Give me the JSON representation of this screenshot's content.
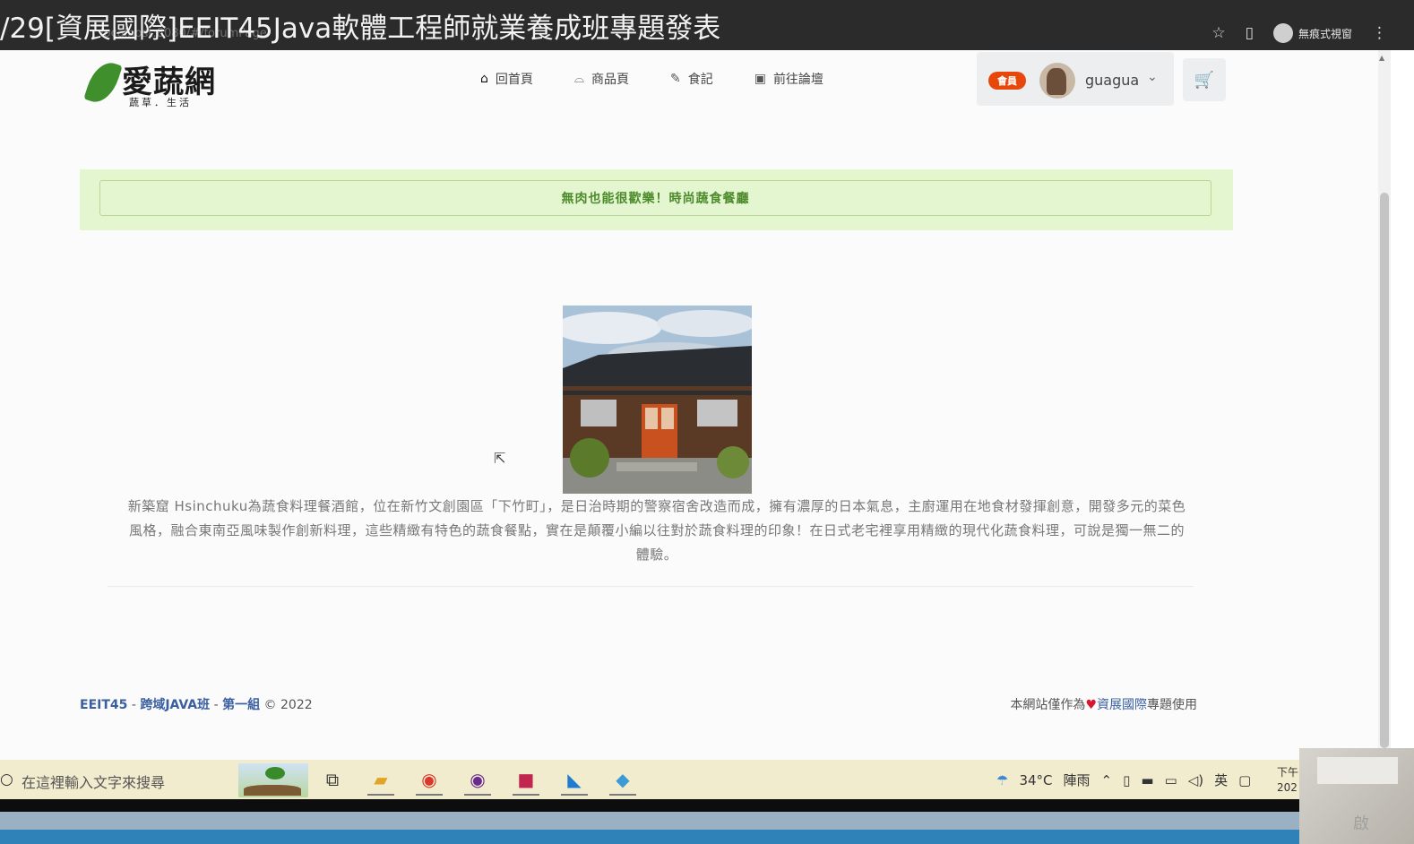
{
  "video_title": "/29[資展國際]EEIT45Java軟體工程師就業養成班專題發表",
  "browser": {
    "address": "localhost:8080/#/forumPage",
    "incognito_label": "無痕式視窗"
  },
  "site": {
    "logo_text": "愛蔬網",
    "logo_sub": "蔬草．生活",
    "nav": [
      {
        "label": "回首頁",
        "icon": "home-icon"
      },
      {
        "label": "商品頁",
        "icon": "bag-icon"
      },
      {
        "label": "食記",
        "icon": "edit-icon"
      },
      {
        "label": "前往論壇",
        "icon": "forum-icon"
      }
    ],
    "user": {
      "badge": "會員",
      "name": "guagua"
    }
  },
  "banner_text": "無肉也能很歡樂！時尚蔬食餐廳",
  "description": "新築窟 Hsinchuku為蔬食料理餐酒館，位在新竹文創園區「下竹町」，是日治時期的警察宿舍改造而成，擁有濃厚的日本氣息，主廚運用在地食材發揮創意，開發多元的菜色風格，融合東南亞風味製作創新料理，這些精緻有特色的蔬食餐點，實在是顛覆小編以往對於蔬食料理的印象！在日式老宅裡享用精緻的現代化蔬食料理，可說是獨一無二的體驗。",
  "footer": {
    "left_link1": "EEIT45",
    "left_sep1": " - ",
    "left_link2": "跨域JAVA班",
    "left_sep2": " - ",
    "left_link3": "第一組",
    "left_copy": " © 2022",
    "right_prefix": "本網站僅作為",
    "right_link": "資展國際",
    "right_suffix": "專題使用"
  },
  "taskbar": {
    "search_placeholder": "在這裡輸入文字來搜尋",
    "weather_temp": "34°C",
    "weather_text": "陣雨",
    "ime": "英",
    "clock_line1": "下午",
    "clock_line2": "202"
  },
  "overlay_watermark": "啟"
}
